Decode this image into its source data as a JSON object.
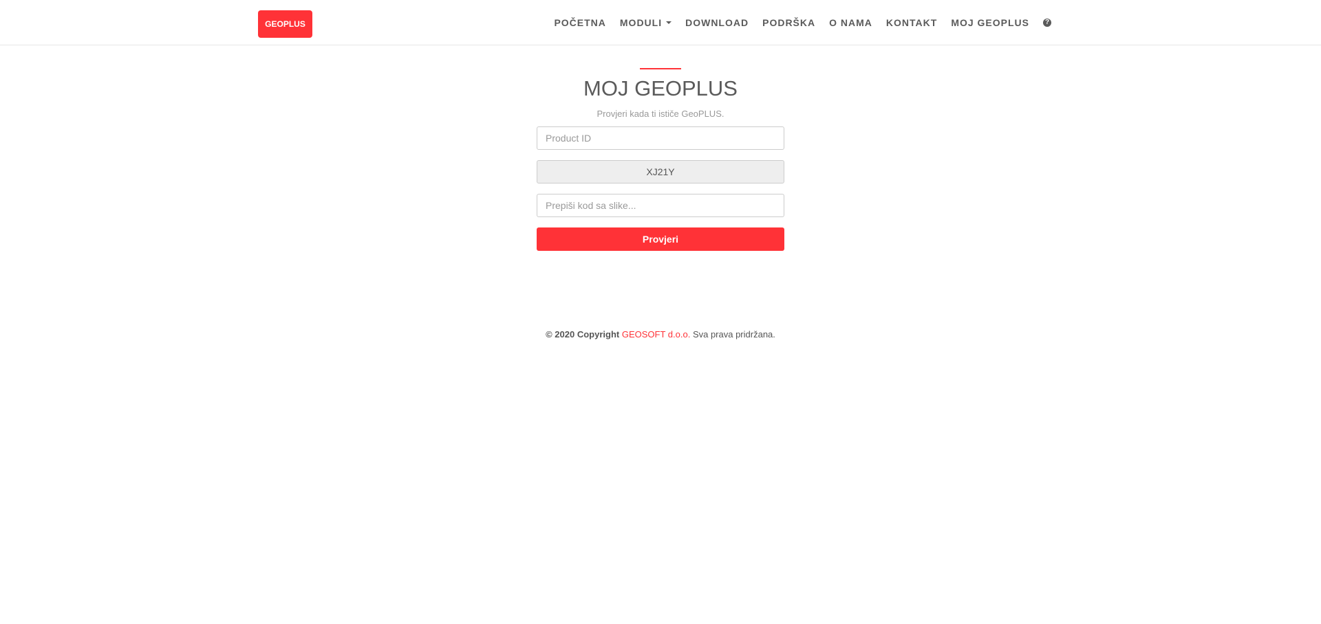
{
  "brand": {
    "label": "GEOPLUS",
    "color": "#ff3237"
  },
  "nav": {
    "items": [
      {
        "label": "POČETNA"
      },
      {
        "label": "MODULI"
      },
      {
        "label": "DOWNLOAD"
      },
      {
        "label": "PODRŠKA"
      },
      {
        "label": "O NAMA"
      },
      {
        "label": "KONTAKT"
      },
      {
        "label": "MOJ GEOPLUS"
      }
    ],
    "help_icon": "question-circle-icon",
    "help_glyph": "?"
  },
  "main": {
    "title": "MOJ GEOPLUS",
    "subtitle": "Provjeri kada ti ističe GeoPLUS.",
    "product_id": {
      "placeholder": "Product ID",
      "value": ""
    },
    "captcha_code": "XJ21Y",
    "captcha_input": {
      "placeholder": "Prepiši kod sa slike...",
      "value": ""
    },
    "submit_label": "Provjeri"
  },
  "footer": {
    "copyright": "© 2020 Copyright",
    "company": "GEOSOFT d.o.o.",
    "rights": "Sva prava pridržana."
  }
}
